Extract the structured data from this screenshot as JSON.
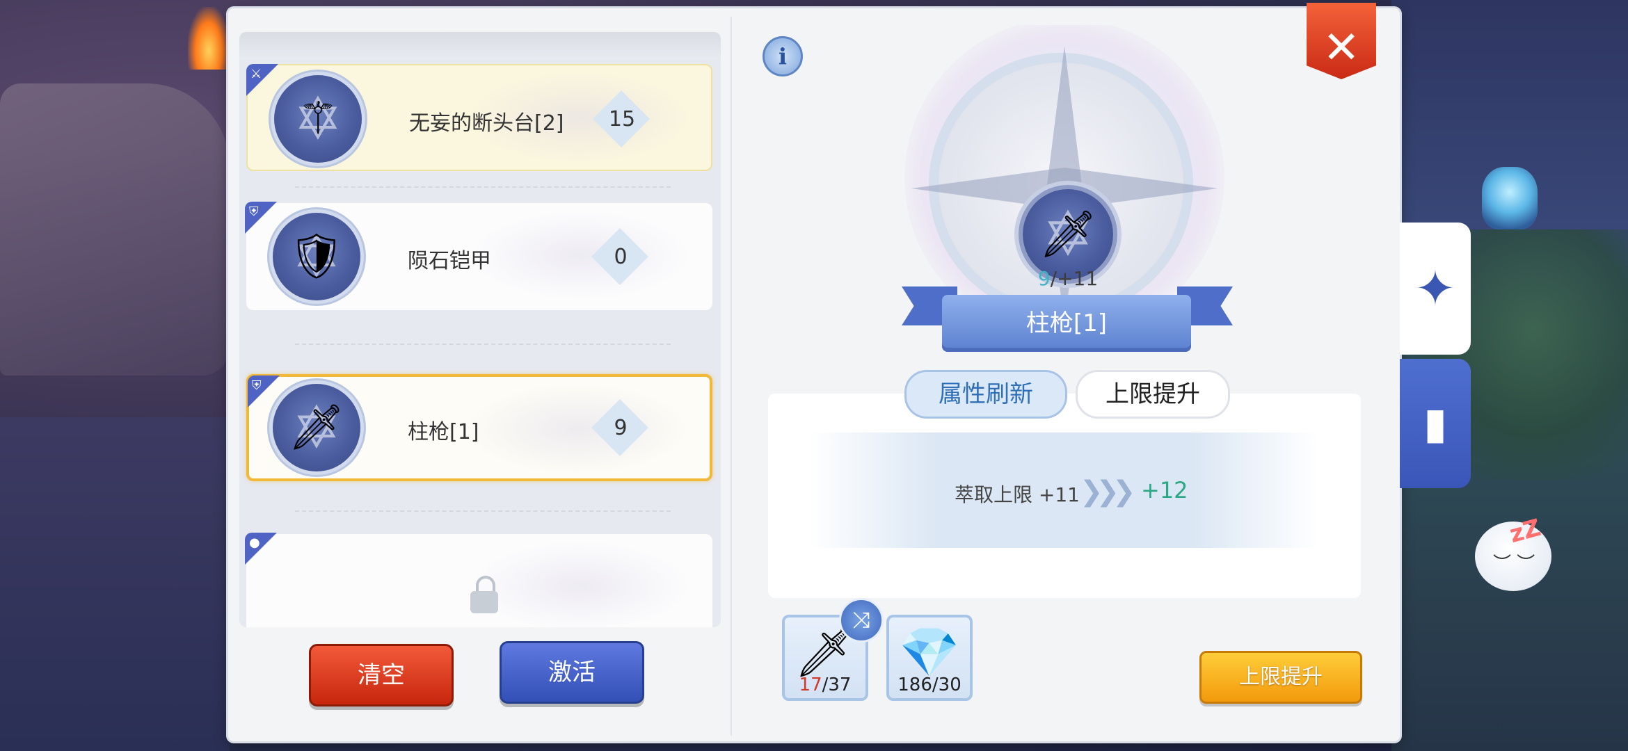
{
  "list": {
    "items": [
      {
        "name": "无妄的断头台[2]",
        "level": "15",
        "type_icon": "sword-icon",
        "equip_icon": "scythe-icon",
        "state": "highlight"
      },
      {
        "name": "陨石铠甲",
        "level": "0",
        "type_icon": "shield-icon",
        "equip_icon": "armor-icon",
        "state": "normal"
      },
      {
        "name": "柱枪[1]",
        "level": "9",
        "type_icon": "shield-icon",
        "equip_icon": "blade-icon",
        "state": "selected"
      },
      {
        "state": "locked",
        "type_icon": "circle-icon"
      }
    ]
  },
  "buttons": {
    "clear": "清空",
    "activate": "激活",
    "upgrade": "上限提升",
    "close": "✕",
    "info": "i"
  },
  "detail": {
    "item_name": "柱枪[1]",
    "current_level": "9",
    "cap_level": "/+11",
    "tabs": {
      "refresh": "属性刷新",
      "upgrade": "上限提升"
    },
    "active_tab": "upgrade",
    "result": {
      "label": "萃取上限 +11",
      "new_value": "+12"
    }
  },
  "materials": [
    {
      "have": "17",
      "need": "/37",
      "icon": "blade-icon",
      "insufficient": true
    },
    {
      "have": "186",
      "need": "/30",
      "icon": "crystal-icon",
      "insufficient": false
    }
  ],
  "side_tabs": [
    {
      "icon": "compass-icon",
      "active": true
    },
    {
      "icon": "book-icon",
      "active": false
    }
  ],
  "colors": {
    "accent_blue": "#4e63c4",
    "selected_border": "#f2b83a",
    "clear_red": "#d73518",
    "activate_blue": "#3f5fc6",
    "upgrade_orange": "#f6ad1f",
    "result_green": "#2aa784",
    "insufficient_red": "#d13a2a"
  }
}
